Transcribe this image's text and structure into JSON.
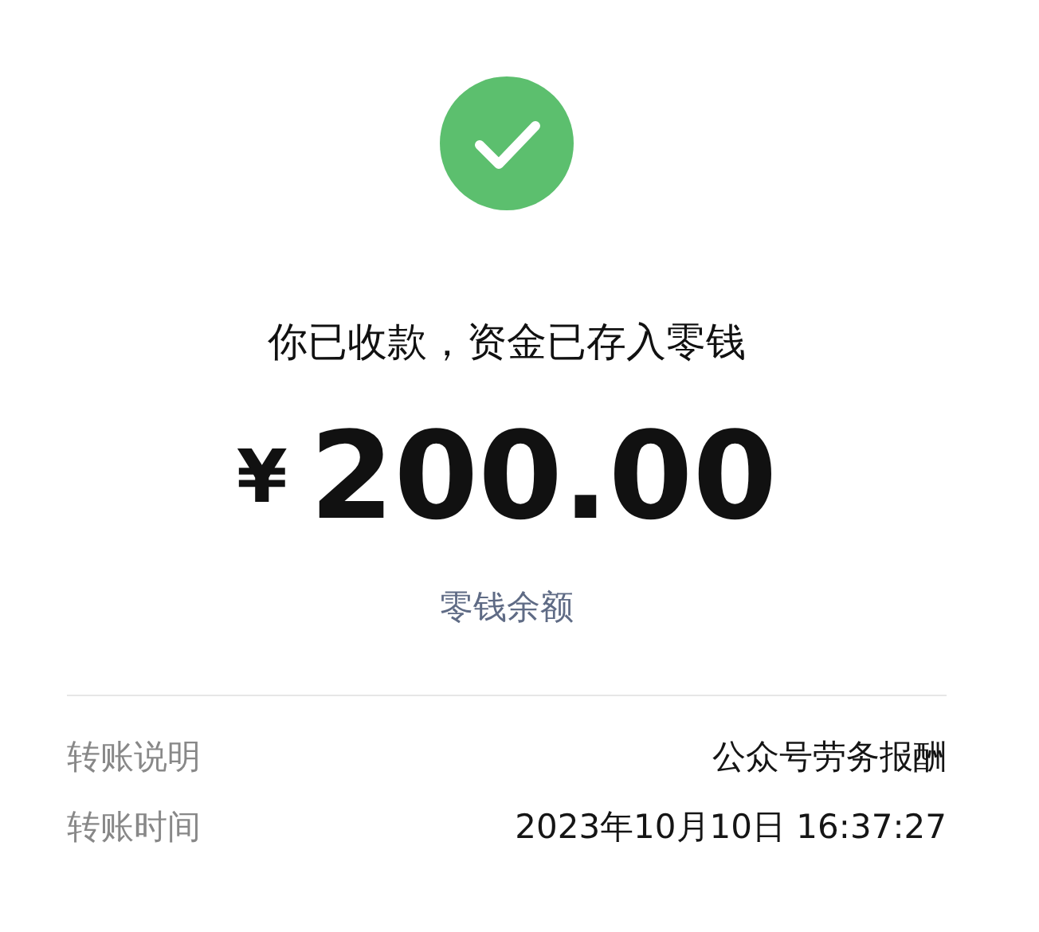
{
  "status": {
    "kind": "success"
  },
  "message": "你已收款，资金已存入零钱",
  "amount": {
    "currency": "¥",
    "value": "200.00"
  },
  "link": "零钱余额",
  "details": [
    {
      "label": "转账说明",
      "value": "公众号劳务报酬"
    },
    {
      "label": "转账时间",
      "value": "2023年10月10日 16:37:27"
    }
  ]
}
